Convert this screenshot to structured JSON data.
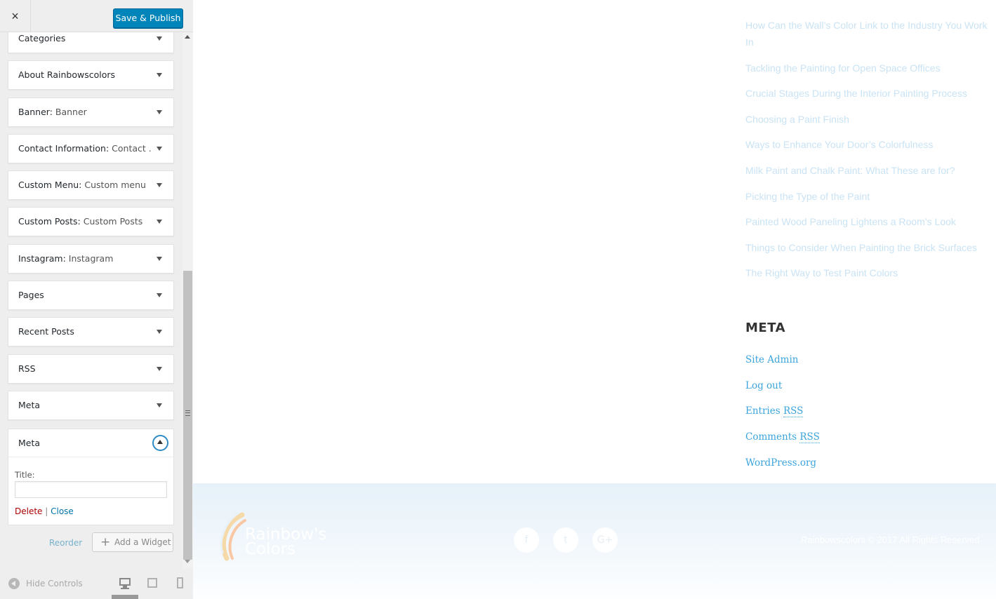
{
  "header": {
    "close_icon": "×",
    "save_label": "Save & Publish"
  },
  "widgets": [
    {
      "name": "Categories",
      "sub": ""
    },
    {
      "name": "About Rainbowscolors",
      "sub": ""
    },
    {
      "name": "Banner:",
      "sub": " Banner"
    },
    {
      "name": "Contact Information:",
      "sub": " Contact ..."
    },
    {
      "name": "Custom Menu:",
      "sub": " Custom menu"
    },
    {
      "name": "Custom Posts:",
      "sub": " Custom Posts"
    },
    {
      "name": "Instagram:",
      "sub": " Instagram"
    },
    {
      "name": "Pages",
      "sub": ""
    },
    {
      "name": "Recent Posts",
      "sub": ""
    },
    {
      "name": "RSS",
      "sub": ""
    },
    {
      "name": "Meta",
      "sub": ""
    }
  ],
  "expanded_widget": {
    "name": "Meta",
    "title_label": "Title:",
    "title_value": "",
    "delete_label": "Delete",
    "separator": " | ",
    "close_label": "Close"
  },
  "panel_actions": {
    "reorder_label": "Reorder",
    "add_widget_label": "Add a Widget",
    "plus_icon": "+"
  },
  "footer_controls": {
    "hide_controls_label": "Hide Controls",
    "devices": [
      "desktop-icon",
      "tablet-icon",
      "mobile-icon"
    ],
    "active_device": "desktop"
  },
  "preview": {
    "recent_posts": [
      "How Can the Wall’s Color Link to the Industry You Work In",
      "Tackling the Painting for Open Space Offices",
      "Crucial Stages During the Interior Painting Process",
      "Choosing a Paint Finish",
      "Ways to Enhance Your Door’s Colorfulness",
      "Milk Paint and Chalk Paint: What These are for?",
      "Picking the Type of the Paint",
      "Painted Wood Paneling Lightens a Room’s Look",
      "Things to Consider When Painting the Brick Surfaces",
      "The Right Way to Test Paint Colors"
    ],
    "meta_heading": "META",
    "meta_links": [
      {
        "pre": "Site Admin",
        "abbr": ""
      },
      {
        "pre": "Log out",
        "abbr": ""
      },
      {
        "pre": "Entries ",
        "abbr": "RSS"
      },
      {
        "pre": "Comments ",
        "abbr": "RSS"
      },
      {
        "pre": "WordPress.org",
        "abbr": ""
      }
    ],
    "footer": {
      "logo_line1": "Rainbow's",
      "logo_line2": "Colors",
      "social_icons": [
        {
          "name": "facebook-icon",
          "glyph": "f"
        },
        {
          "name": "twitter-icon",
          "glyph": "t"
        },
        {
          "name": "google-plus-icon",
          "glyph": "G+"
        }
      ],
      "copyright": "Rainbowscolors © 2017 All Rights Reserved"
    }
  },
  "colors": {
    "primary_button": "#0085ba",
    "link_blue": "#3ba4dc",
    "faded_link": "#c9e3f4",
    "delete_red": "#a00000",
    "panel_bg": "#eeeeee"
  }
}
